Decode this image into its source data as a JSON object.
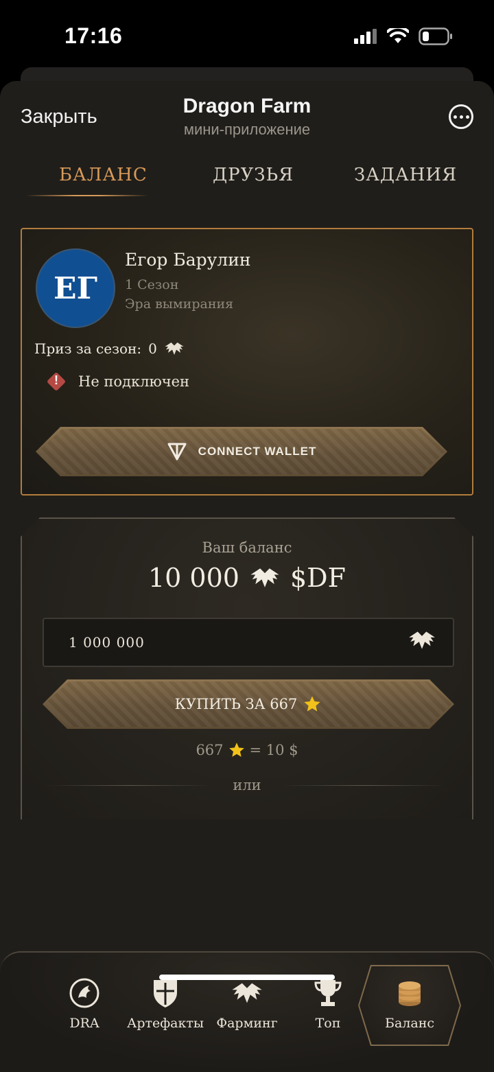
{
  "status_bar": {
    "time": "17:16"
  },
  "header": {
    "close_label": "Закрыть",
    "title": "Dragon Farm",
    "subtitle": "мини-приложение"
  },
  "tabs": [
    {
      "label": "БАЛАНС",
      "active": true
    },
    {
      "label": "ДРУЗЬЯ",
      "active": false
    },
    {
      "label": "ЗАДАНИЯ",
      "active": false
    }
  ],
  "profile": {
    "initials": "ЕГ",
    "name": "Егор Барулин",
    "season": "1 Сезон",
    "era": "Эра вымирания",
    "prize_label": "Приз за сезон:",
    "prize_value": "0",
    "connection_status": "Не подключен",
    "connect_button": "CONNECT WALLET"
  },
  "balance": {
    "label": "Ваш баланс",
    "value": "10 000",
    "currency": "$DF",
    "amount_input_value": "1 000 000",
    "buy_button": "КУПИТЬ ЗА 667",
    "rate_left": "667",
    "rate_right": "= 10 $",
    "or_label": "или"
  },
  "bottom_nav": [
    {
      "label": "DRA",
      "icon": "dragon-coin-icon"
    },
    {
      "label": "Артефакты",
      "icon": "shield-icon"
    },
    {
      "label": "Фарминг",
      "icon": "dragon-wings-icon"
    },
    {
      "label": "Топ",
      "icon": "trophy-icon"
    },
    {
      "label": "Баланс",
      "icon": "coin-stack-icon",
      "active": true
    }
  ],
  "colors": {
    "accent_tab": "#d89a5a",
    "card_border": "#b27d3c",
    "avatar_bg": "#114f93",
    "star": "#f2c21a",
    "warning": "#b54a44"
  }
}
